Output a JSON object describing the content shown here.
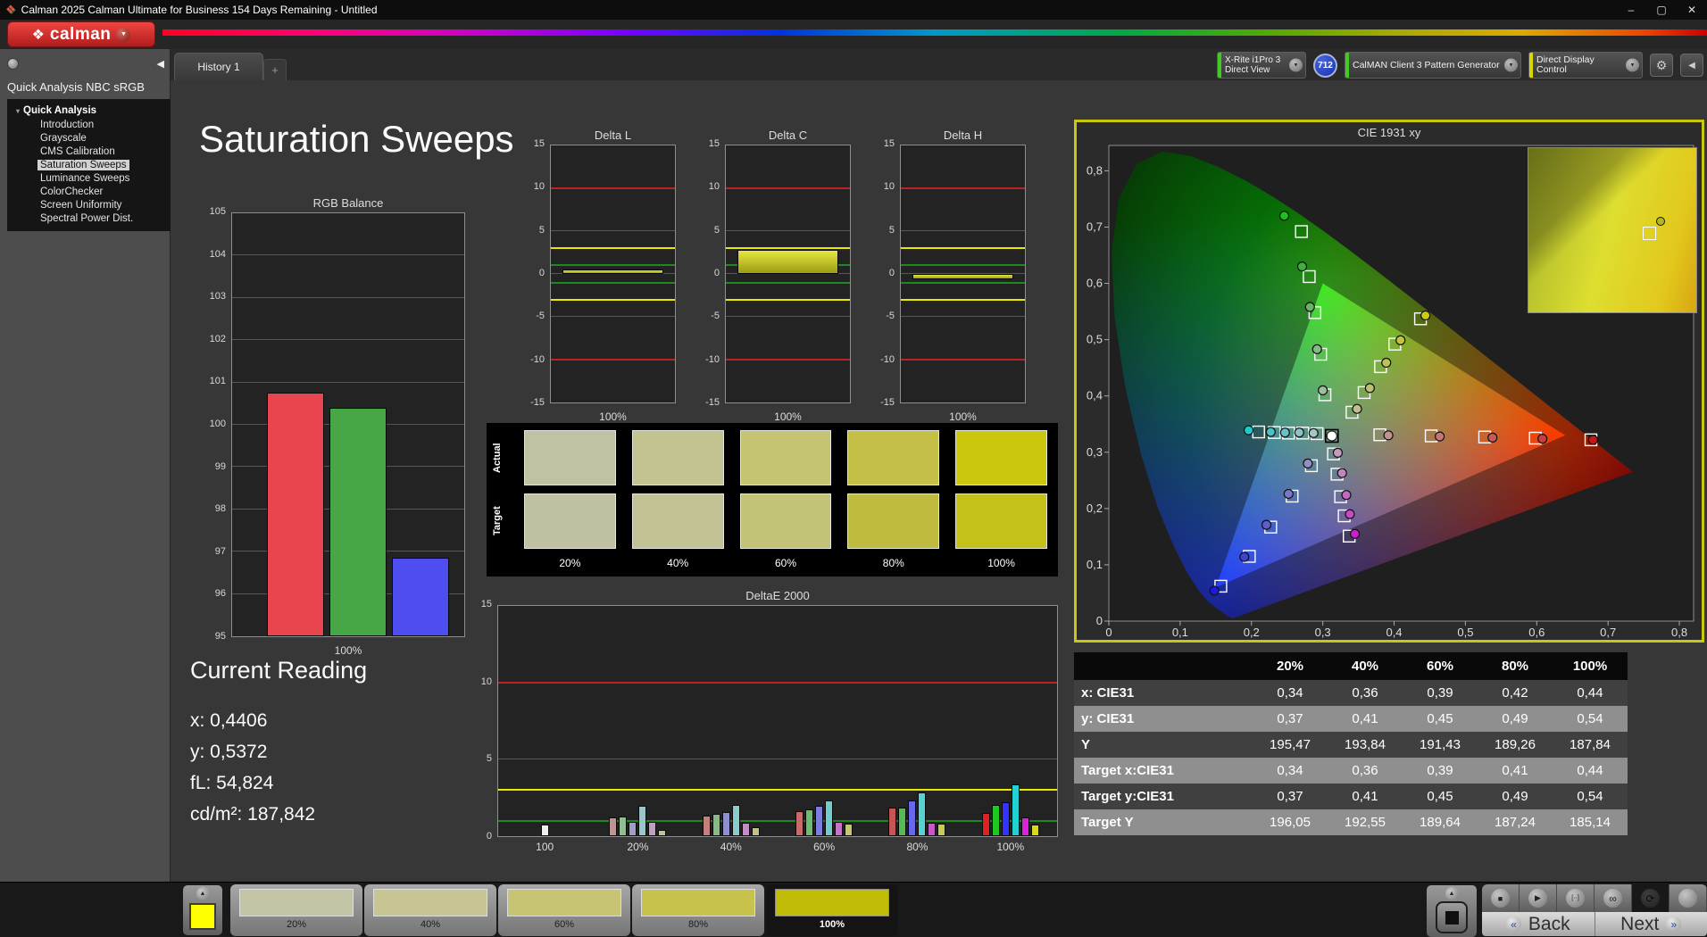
{
  "window": {
    "icon": "❖",
    "title": "Calman 2025 Calman Ultimate for Business 154 Days Remaining  - Untitled",
    "minimize": "–",
    "maximize": "▢",
    "close": "✕"
  },
  "header": {
    "logo_icon": "❖",
    "logo": "calman",
    "dropdown_icon": "▼"
  },
  "tabs": {
    "history": "History 1",
    "add": "+"
  },
  "toolbar": {
    "meter_line1": "X-Rite i1Pro 3",
    "meter_line2": "Direct View",
    "meter_badge": "712",
    "pattern_label": "CalMAN Client 3 Pattern Generator",
    "display_label": "Direct Display Control",
    "meter_accent": "#3ecc1e",
    "pattern_accent": "#3ecc1e",
    "display_accent": "#d8d800",
    "gear_icon": "⚙",
    "collapse_icon": "◀"
  },
  "sidebar": {
    "collapse_icon": "◀",
    "workflow_title": "Quick Analysis NBC sRGB",
    "expander": "▾",
    "root": "Quick Analysis",
    "items": [
      {
        "label": "Introduction",
        "selected": false
      },
      {
        "label": "Grayscale",
        "selected": false
      },
      {
        "label": "CMS Calibration",
        "selected": false
      },
      {
        "label": "Saturation Sweeps",
        "selected": true
      },
      {
        "label": "Luminance Sweeps",
        "selected": false
      },
      {
        "label": "ColorChecker",
        "selected": false
      },
      {
        "label": "Screen Uniformity",
        "selected": false
      },
      {
        "label": "Spectral Power Dist.",
        "selected": false
      }
    ]
  },
  "page_title": "Saturation Sweeps",
  "current_reading": {
    "heading": "Current Reading",
    "values": [
      "x: 0,4406",
      "y: 0,5372",
      "fL: 54,824",
      "cd/m²: 187,842"
    ]
  },
  "swatch_panel": {
    "row_labels": [
      "Actual",
      "Target"
    ],
    "col_labels": [
      "20%",
      "40%",
      "60%",
      "80%",
      "100%"
    ],
    "actual_colors": [
      "#c1c1a3",
      "#c3c291",
      "#c5c473",
      "#c4c047",
      "#cac70f"
    ],
    "target_colors": [
      "#c0c0a2",
      "#c2c294",
      "#c3c378",
      "#bebb3e",
      "#c4c11b"
    ]
  },
  "results_table": {
    "columns": [
      "",
      "20%",
      "40%",
      "60%",
      "80%",
      "100%"
    ],
    "rows": [
      {
        "label": "x: CIE31",
        "values": [
          "0,34",
          "0,36",
          "0,39",
          "0,42",
          "0,44"
        ],
        "shade": "dark"
      },
      {
        "label": "y: CIE31",
        "values": [
          "0,37",
          "0,41",
          "0,45",
          "0,49",
          "0,54"
        ],
        "shade": "light"
      },
      {
        "label": "Y",
        "values": [
          "195,47",
          "193,84",
          "191,43",
          "189,26",
          "187,84"
        ],
        "shade": "dark"
      },
      {
        "label": "Target x:CIE31",
        "values": [
          "0,34",
          "0,36",
          "0,39",
          "0,41",
          "0,44"
        ],
        "shade": "light"
      },
      {
        "label": "Target y:CIE31",
        "values": [
          "0,37",
          "0,41",
          "0,45",
          "0,49",
          "0,54"
        ],
        "shade": "dark"
      },
      {
        "label": "Target Y",
        "values": [
          "196,05",
          "192,55",
          "189,64",
          "187,24",
          "185,14"
        ],
        "shade": "light"
      }
    ]
  },
  "bottom_bar": {
    "up_icon": "▲",
    "preview_color": "#ffff00",
    "patterns": [
      {
        "label": "20%",
        "color": "#c4c4a6",
        "selected": false
      },
      {
        "label": "40%",
        "color": "#c6c593",
        "selected": false
      },
      {
        "label": "60%",
        "color": "#c7c574",
        "selected": false
      },
      {
        "label": "80%",
        "color": "#c6c24c",
        "selected": false
      },
      {
        "label": "100%",
        "color": "#c1bc08",
        "selected": true
      }
    ],
    "stop_icon": "■",
    "play_icon": "▶",
    "step_icon": "[··]",
    "loop_icon": "∞",
    "refresh_icon": "⟳",
    "back_chevron": "«",
    "back": "Back",
    "next": "Next",
    "next_chevron": "»"
  },
  "chart_data": [
    {
      "id": "rgb_balance",
      "type": "bar",
      "title": "RGB Balance",
      "categories": [
        "Red",
        "Green",
        "Blue"
      ],
      "values": [
        100.75,
        100.4,
        96.85
      ],
      "bar_colors": [
        "#e8454f",
        "#47a747",
        "#4d4df0"
      ],
      "xlabel": "100%",
      "ylim": [
        95,
        105
      ],
      "yticks": [
        105,
        104,
        103,
        102,
        101,
        100,
        99,
        98,
        97,
        96,
        95
      ]
    },
    {
      "id": "delta_l",
      "type": "bar",
      "title": "Delta L",
      "categories": [
        "100%"
      ],
      "values": [
        0.5
      ],
      "xlabel": "100%",
      "ylim": [
        -15,
        15
      ],
      "yticks": [
        15,
        10,
        5,
        0,
        -5,
        -10,
        -15
      ],
      "refs": [
        {
          "v": 10,
          "c": "#bb2222"
        },
        {
          "v": -10,
          "c": "#bb2222"
        },
        {
          "v": 3,
          "c": "#e8e800"
        },
        {
          "v": -3,
          "c": "#e8e800"
        },
        {
          "v": 1,
          "c": "#1e8a1e"
        },
        {
          "v": -1,
          "c": "#1e8a1e"
        }
      ]
    },
    {
      "id": "delta_c",
      "type": "bar",
      "title": "Delta C",
      "categories": [
        "100%"
      ],
      "values": [
        2.8
      ],
      "xlabel": "100%",
      "ylim": [
        -15,
        15
      ],
      "yticks": [
        15,
        10,
        5,
        0,
        -5,
        -10,
        -15
      ],
      "refs": [
        {
          "v": 10,
          "c": "#bb2222"
        },
        {
          "v": -10,
          "c": "#bb2222"
        },
        {
          "v": 3,
          "c": "#e8e800"
        },
        {
          "v": -3,
          "c": "#e8e800"
        },
        {
          "v": 1,
          "c": "#1e8a1e"
        },
        {
          "v": -1,
          "c": "#1e8a1e"
        }
      ]
    },
    {
      "id": "delta_h",
      "type": "bar",
      "title": "Delta H",
      "categories": [
        "100%"
      ],
      "values": [
        -0.6
      ],
      "xlabel": "100%",
      "ylim": [
        -15,
        15
      ],
      "yticks": [
        15,
        10,
        5,
        0,
        -5,
        -10,
        -15
      ],
      "refs": [
        {
          "v": 10,
          "c": "#bb2222"
        },
        {
          "v": -10,
          "c": "#bb2222"
        },
        {
          "v": 3,
          "c": "#e8e800"
        },
        {
          "v": -3,
          "c": "#e8e800"
        },
        {
          "v": 1,
          "c": "#1e8a1e"
        },
        {
          "v": -1,
          "c": "#1e8a1e"
        }
      ]
    },
    {
      "id": "deltae2000",
      "type": "grouped-bar",
      "title": "DeltaE 2000",
      "ylim": [
        0,
        15
      ],
      "yticks": [
        15,
        10,
        5,
        0
      ],
      "refs": [
        {
          "v": 10,
          "c": "#bb2222"
        },
        {
          "v": 3,
          "c": "#e8e800"
        },
        {
          "v": 1,
          "c": "#1e8a1e"
        }
      ],
      "groups": [
        {
          "label": "100",
          "values": [
            0.75
          ],
          "colors": [
            "#f0f0f0"
          ]
        },
        {
          "label": "20%",
          "values": [
            1.2,
            1.3,
            0.95,
            2.0,
            0.95,
            0.4
          ],
          "colors": [
            "#c49090",
            "#94bc94",
            "#9e9ec8",
            "#9cc6c6",
            "#c49cc4",
            "#c2c29a"
          ]
        },
        {
          "label": "40%",
          "values": [
            1.35,
            1.45,
            1.55,
            2.05,
            0.85,
            0.6
          ],
          "colors": [
            "#c47f7f",
            "#85bc85",
            "#8f8fd0",
            "#8accc8",
            "#c48cc4",
            "#c2c285"
          ]
        },
        {
          "label": "60%",
          "values": [
            1.65,
            1.75,
            1.95,
            2.35,
            0.95,
            0.8
          ],
          "colors": [
            "#c66a6a",
            "#6fbc6f",
            "#7d7dde",
            "#72cccc",
            "#c673c6",
            "#c6c66e"
          ]
        },
        {
          "label": "80%",
          "values": [
            1.85,
            1.85,
            2.3,
            2.85,
            0.9,
            0.8
          ],
          "colors": [
            "#c85555",
            "#55bc55",
            "#6868ec",
            "#55d2d2",
            "#c858c8",
            "#caca52"
          ]
        },
        {
          "label": "100%",
          "values": [
            1.5,
            2.05,
            2.2,
            3.4,
            1.25,
            0.75
          ],
          "colors": [
            "#dd2222",
            "#22c822",
            "#3333ff",
            "#22d2d2",
            "#dd22dd",
            "#d8d822"
          ]
        }
      ]
    },
    {
      "id": "cie",
      "type": "scatter",
      "title": "CIE 1931 xy",
      "xlim": [
        0,
        0.8
      ],
      "ylim": [
        0,
        0.8
      ],
      "xticks": [
        "0",
        "0,1",
        "0,2",
        "0,3",
        "0,4",
        "0,5",
        "0,6",
        "0,7",
        "0,8"
      ],
      "yticks": [
        "0",
        "0,1",
        "0,2",
        "0,3",
        "0,4",
        "0,5",
        "0,6",
        "0,7",
        "0,8"
      ],
      "white_point": {
        "target": [
          0.3127,
          0.329
        ],
        "color": "#ffffff"
      },
      "sweeps": [
        {
          "name": "red",
          "targets": [
            [
              0.38,
              0.331
            ],
            [
              0.452,
              0.329
            ],
            [
              0.527,
              0.327
            ],
            [
              0.598,
              0.325
            ],
            [
              0.676,
              0.322
            ]
          ],
          "measured": [
            [
              0.392,
              0.33
            ],
            [
              0.464,
              0.328
            ],
            [
              0.538,
              0.326
            ],
            [
              0.608,
              0.324
            ],
            [
              0.679,
              0.322
            ]
          ],
          "colors": [
            "#c49090",
            "#c47676",
            "#c65a5a",
            "#c83d3d",
            "#cc1616"
          ]
        },
        {
          "name": "green",
          "targets": [
            [
              0.303,
              0.402
            ],
            [
              0.297,
              0.474
            ],
            [
              0.289,
              0.548
            ],
            [
              0.281,
              0.612
            ],
            [
              0.27,
              0.692
            ]
          ],
          "measured": [
            [
              0.3,
              0.41
            ],
            [
              0.292,
              0.483
            ],
            [
              0.282,
              0.558
            ],
            [
              0.271,
              0.63
            ],
            [
              0.246,
              0.72
            ]
          ],
          "colors": [
            "#9cbf9c",
            "#84ba84",
            "#68b468",
            "#42ae42",
            "#16c616"
          ]
        },
        {
          "name": "blue",
          "targets": [
            [
              0.284,
              0.276
            ],
            [
              0.257,
              0.222
            ],
            [
              0.227,
              0.167
            ],
            [
              0.197,
              0.115
            ],
            [
              0.157,
              0.062
            ]
          ],
          "measured": [
            [
              0.279,
              0.28
            ],
            [
              0.252,
              0.226
            ],
            [
              0.221,
              0.171
            ],
            [
              0.19,
              0.114
            ],
            [
              0.148,
              0.054
            ]
          ],
          "colors": [
            "#9090c4",
            "#7878c6",
            "#5e5ec8",
            "#4242cc",
            "#1a1add"
          ]
        },
        {
          "name": "cyan",
          "targets": [
            [
              0.292,
              0.333
            ],
            [
              0.272,
              0.334
            ],
            [
              0.252,
              0.334
            ],
            [
              0.232,
              0.335
            ],
            [
              0.21,
              0.336
            ]
          ],
          "measured": [
            [
              0.287,
              0.334
            ],
            [
              0.267,
              0.335
            ],
            [
              0.247,
              0.335
            ],
            [
              0.227,
              0.336
            ],
            [
              0.196,
              0.339
            ]
          ],
          "colors": [
            "#a6c6c6",
            "#8cc2c2",
            "#6cc0c0",
            "#48c2c2",
            "#1ccccc"
          ]
        },
        {
          "name": "magenta",
          "targets": [
            [
              0.315,
              0.297
            ],
            [
              0.32,
              0.261
            ],
            [
              0.325,
              0.221
            ],
            [
              0.33,
              0.187
            ],
            [
              0.337,
              0.151
            ]
          ],
          "measured": [
            [
              0.321,
              0.299
            ],
            [
              0.327,
              0.263
            ],
            [
              0.333,
              0.224
            ],
            [
              0.338,
              0.19
            ],
            [
              0.345,
              0.155
            ]
          ],
          "colors": [
            "#c09cc0",
            "#c086c0",
            "#c26ac2",
            "#c44cc4",
            "#cc1ecc"
          ]
        },
        {
          "name": "yellow",
          "targets": [
            [
              0.341,
              0.371
            ],
            [
              0.358,
              0.406
            ],
            [
              0.381,
              0.452
            ],
            [
              0.401,
              0.492
            ],
            [
              0.437,
              0.537
            ]
          ],
          "measured": [
            [
              0.348,
              0.377
            ],
            [
              0.366,
              0.414
            ],
            [
              0.389,
              0.459
            ],
            [
              0.409,
              0.499
            ],
            [
              0.444,
              0.543
            ]
          ],
          "colors": [
            "#c0c08c",
            "#bfbf72",
            "#c0c056",
            "#c4c43a",
            "#cccc16"
          ]
        }
      ]
    }
  ]
}
